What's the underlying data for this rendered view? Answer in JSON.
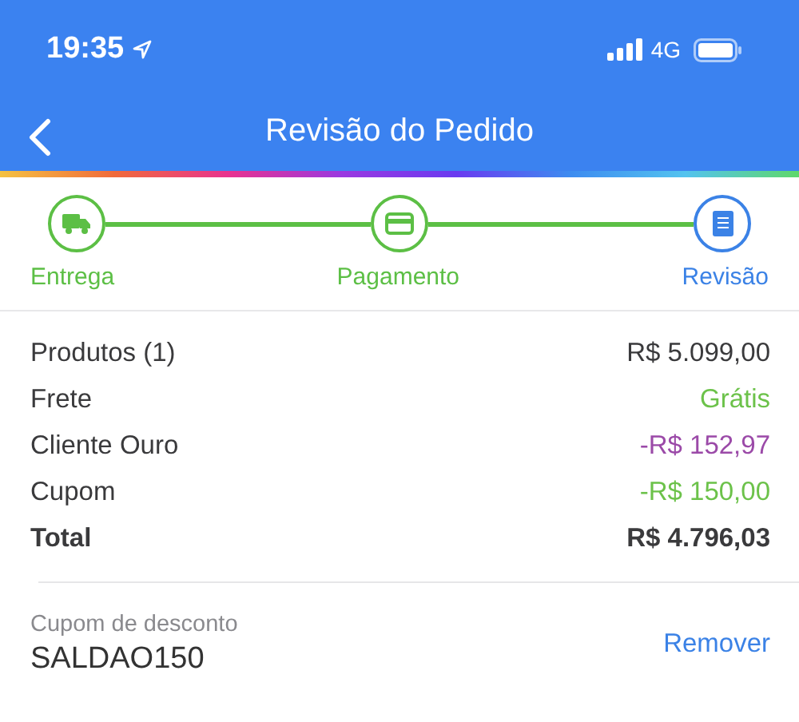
{
  "status_bar": {
    "time": "19:35",
    "network": "4G"
  },
  "nav": {
    "title": "Revisão do Pedido"
  },
  "steps": [
    {
      "label": "Entrega",
      "kind": "delivery",
      "current": false
    },
    {
      "label": "Pagamento",
      "kind": "payment",
      "current": false
    },
    {
      "label": "Revisão",
      "kind": "review",
      "current": true
    }
  ],
  "summary": [
    {
      "label": "Produtos (1)",
      "value": "R$ 5.099,00",
      "kind": "line",
      "color": "#3a3a3c"
    },
    {
      "label": "Frete",
      "value": "Grátis",
      "kind": "line",
      "color": "#6cc24a"
    },
    {
      "label": "Cliente Ouro",
      "value": "-R$ 152,97",
      "kind": "line",
      "color": "#9b4aa8"
    },
    {
      "label": "Cupom",
      "value": "-R$ 150,00",
      "kind": "line",
      "color": "#6cc24a"
    },
    {
      "label": "Total",
      "value": "R$ 4.796,03",
      "kind": "total",
      "color": "#3a3a3c"
    }
  ],
  "coupon": {
    "label": "Cupom de desconto",
    "value": "SALDAO150",
    "action": "Remover"
  }
}
